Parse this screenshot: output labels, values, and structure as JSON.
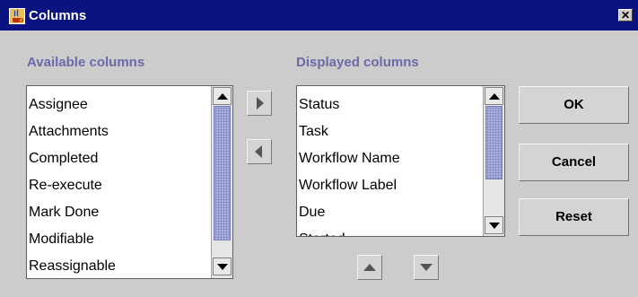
{
  "window": {
    "title": "Columns",
    "close_glyph": "✕",
    "icon": "java-cup-icon"
  },
  "available": {
    "label": "Available columns",
    "items": [
      "Assignee",
      "Attachments",
      "Completed",
      "Re-execute",
      "Mark Done",
      "Modifiable",
      "Reassignable"
    ]
  },
  "displayed": {
    "label": "Displayed columns",
    "items": [
      "Status",
      "Task",
      "Workflow Name",
      "Workflow Label",
      "Due",
      "Started"
    ]
  },
  "transfer": {
    "add_icon": "arrow-right-icon",
    "remove_icon": "arrow-left-icon"
  },
  "order": {
    "up_icon": "arrow-up-icon",
    "down_icon": "arrow-down-icon"
  },
  "buttons": {
    "ok": "OK",
    "cancel": "Cancel",
    "reset": "Reset"
  },
  "colors": {
    "titlebar": "#0a1380",
    "section_label": "#6a6aa8",
    "scroll_thumb": "#aab0dc",
    "background": "#cccccc"
  }
}
